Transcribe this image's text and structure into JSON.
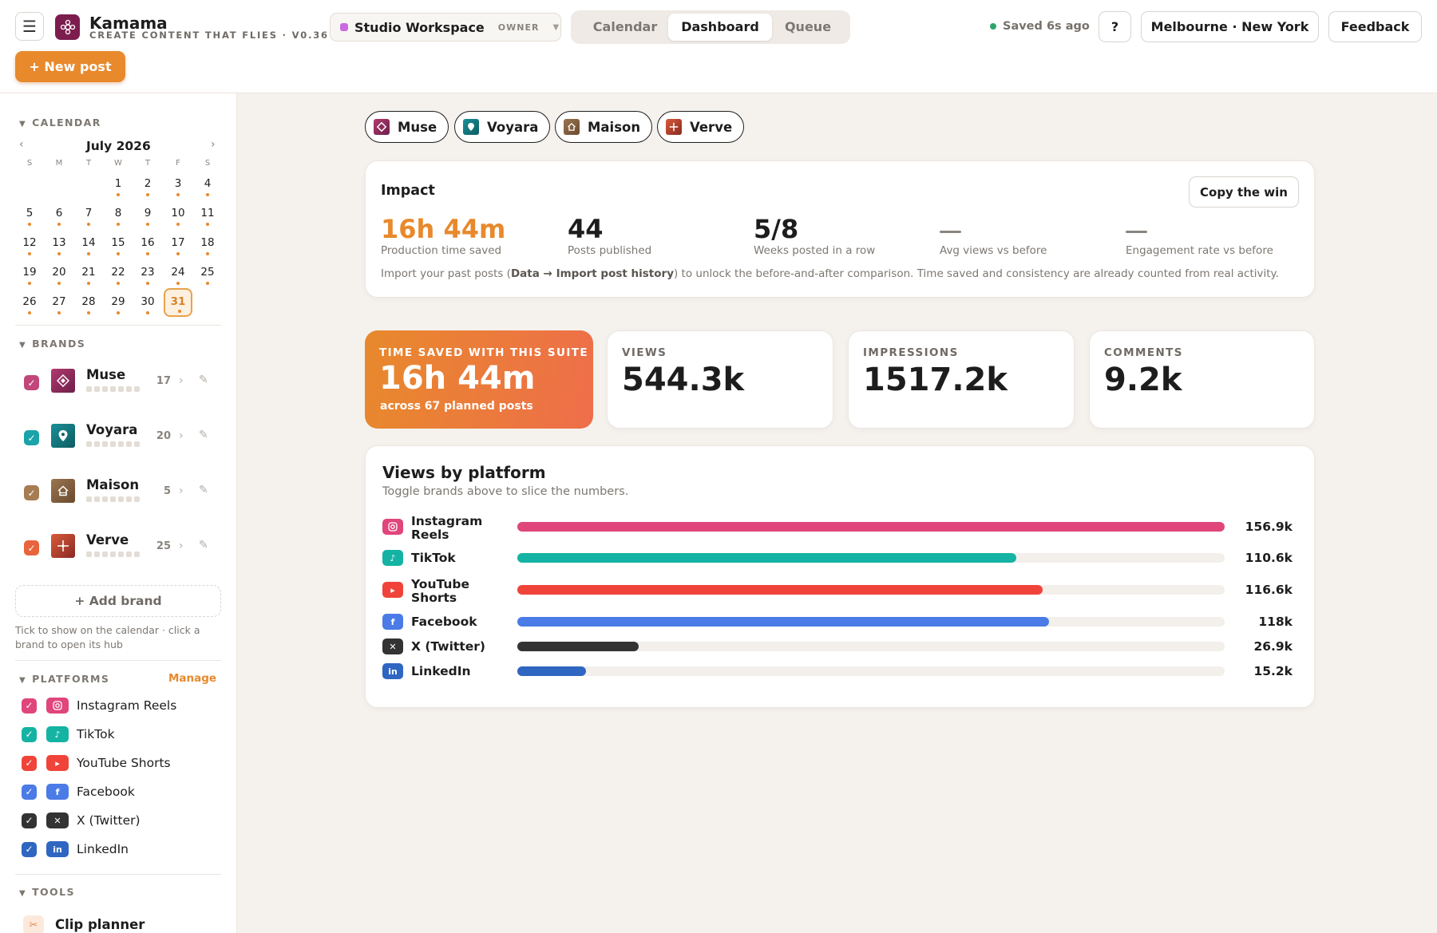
{
  "app": {
    "name": "Kamama",
    "tagline": "CREATE CONTENT THAT FLIES · V0.36"
  },
  "workspace": {
    "name": "Studio Workspace",
    "role": "OWNER"
  },
  "tabs": [
    {
      "label": "Calendar"
    },
    {
      "label": "Dashboard",
      "active": true
    },
    {
      "label": "Queue"
    }
  ],
  "header": {
    "saved": "Saved 6s ago",
    "help": "?",
    "timezones": "Melbourne · New York",
    "feedback": "Feedback",
    "new_post": "+ New post"
  },
  "sidebar": {
    "calendar": {
      "heading": "CALENDAR",
      "month": "July 2026",
      "weekdays": [
        "S",
        "M",
        "T",
        "W",
        "T",
        "F",
        "S"
      ],
      "first_weekday_index": 3,
      "days": 31,
      "today": 31,
      "days_with_posts": [
        1,
        2,
        3,
        4,
        5,
        6,
        7,
        8,
        9,
        10,
        11,
        12,
        13,
        14,
        15,
        16,
        17,
        18,
        19,
        20,
        21,
        22,
        23,
        24,
        25,
        26,
        27,
        28,
        29,
        30,
        31
      ]
    },
    "brands_heading": "BRANDS",
    "brands": [
      {
        "name": "Muse",
        "count": "17",
        "color": "#c2467a",
        "icon": "diamond-icon"
      },
      {
        "name": "Voyara",
        "count": "20",
        "color": "#1aa3a8",
        "icon": "location-pin-icon"
      },
      {
        "name": "Maison",
        "count": "5",
        "color": "#a67c52",
        "icon": "house-icon"
      },
      {
        "name": "Verve",
        "count": "25",
        "color": "#e8643c",
        "icon": "sparkle-icon"
      }
    ],
    "add_brand": "+ Add brand",
    "brand_hint": "Tick to show on the calendar · click a brand to open its hub",
    "platforms_heading": "PLATFORMS",
    "manage": "Manage",
    "platforms": [
      {
        "name": "Instagram Reels",
        "color": "#e0457b",
        "icon": "instagram-icon"
      },
      {
        "name": "TikTok",
        "color": "#14b3a3",
        "icon": "tiktok-icon"
      },
      {
        "name": "YouTube Shorts",
        "color": "#f0433a",
        "icon": "youtube-icon"
      },
      {
        "name": "Facebook",
        "color": "#4a7be6",
        "icon": "facebook-icon"
      },
      {
        "name": "X (Twitter)",
        "color": "#333333",
        "icon": "x-icon"
      },
      {
        "name": "LinkedIn",
        "color": "#2e66c2",
        "icon": "linkedin-icon"
      }
    ],
    "tools_heading": "TOOLS",
    "tools": [
      {
        "name": "Clip planner",
        "icon": "scissors-icon"
      }
    ]
  },
  "brand_chips": [
    "Muse",
    "Voyara",
    "Maison",
    "Verve"
  ],
  "impact": {
    "title": "Impact",
    "copy_button": "Copy the win",
    "stats": [
      {
        "value": "16h 44m",
        "label": "Production time saved"
      },
      {
        "value": "44",
        "label": "Posts published"
      },
      {
        "value": "5/8",
        "label": "Weeks posted in a row"
      },
      {
        "value": "—",
        "label": "Avg views vs before"
      },
      {
        "value": "—",
        "label": "Engagement rate vs before"
      }
    ],
    "note_pre": "Import your past posts (",
    "note_data": "Data",
    "note_arrow": " → ",
    "note_import": "Import post history",
    "note_post": ") to unlock the before-and-after comparison. Time saved and consistency are already counted from real activity."
  },
  "kpis": {
    "time_saved": {
      "label": "TIME SAVED WITH THIS SUITE",
      "value": "16h 44m",
      "sub": "across 67 planned posts"
    },
    "views": {
      "label": "VIEWS",
      "value": "544.3k"
    },
    "impressions": {
      "label": "IMPRESSIONS",
      "value": "1517.2k"
    },
    "comments": {
      "label": "COMMENTS",
      "value": "9.2k"
    }
  },
  "views_by_platform": {
    "title": "Views by platform",
    "subtitle": "Toggle brands above to slice the numbers.",
    "scale_max": 156.9,
    "rows": [
      {
        "name": "Instagram Reels",
        "value": 156.9,
        "display": "156.9k",
        "color": "#e0457b"
      },
      {
        "name": "TikTok",
        "value": 110.6,
        "display": "110.6k",
        "color": "#14b3a3"
      },
      {
        "name": "YouTube Shorts",
        "value": 116.6,
        "display": "116.6k",
        "color": "#f0433a"
      },
      {
        "name": "Facebook",
        "value": 118,
        "display": "118k",
        "color": "#4a7be6"
      },
      {
        "name": "X (Twitter)",
        "value": 26.9,
        "display": "26.9k",
        "color": "#333333"
      },
      {
        "name": "LinkedIn",
        "value": 15.2,
        "display": "15.2k",
        "color": "#2e66c2"
      }
    ]
  }
}
